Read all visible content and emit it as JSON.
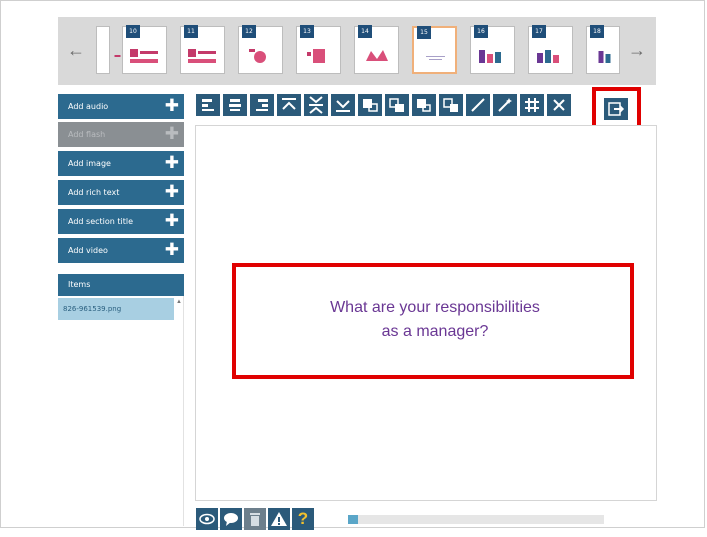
{
  "thumbnails": [
    {
      "num": "",
      "active": false
    },
    {
      "num": "10",
      "active": false
    },
    {
      "num": "11",
      "active": false
    },
    {
      "num": "12",
      "active": false
    },
    {
      "num": "13",
      "active": false
    },
    {
      "num": "14",
      "active": false
    },
    {
      "num": "15",
      "active": true
    },
    {
      "num": "16",
      "active": false
    },
    {
      "num": "17",
      "active": false
    },
    {
      "num": "18",
      "active": false
    }
  ],
  "nav": {
    "prev_icon": "arrow-left-icon",
    "next_icon": "arrow-right-icon"
  },
  "left_panel": {
    "buttons": [
      {
        "label": "Add audio",
        "enabled": true
      },
      {
        "label": "Add flash",
        "enabled": false
      },
      {
        "label": "Add image",
        "enabled": true
      },
      {
        "label": "Add rich text",
        "enabled": true
      },
      {
        "label": "Add section title",
        "enabled": true
      },
      {
        "label": "Add video",
        "enabled": true
      }
    ],
    "plus_glyph": "✚",
    "items_heading": "Items",
    "items": [
      "826-961539.png"
    ]
  },
  "toolbar": {
    "icons": [
      "align-left-icon",
      "align-center-icon",
      "align-right-icon",
      "align-top-icon",
      "align-middle-icon",
      "align-bottom-icon",
      "bring-front-icon",
      "bring-forward-icon",
      "send-backward-icon",
      "send-back-icon",
      "draw-line-icon",
      "magic-wand-icon",
      "grid-icon",
      "close-icon",
      "export-icon"
    ]
  },
  "slide": {
    "text_line1": "What are your responsibilities",
    "text_line2": "as a manager?"
  },
  "bottom_bar": {
    "icons": [
      "preview-eye-icon",
      "comment-icon",
      "trash-icon",
      "warning-icon",
      "help-icon"
    ],
    "help_glyph": "?",
    "progress": 0.04
  },
  "colors": {
    "accent": "#2c6a8f",
    "highlight": "#e00000",
    "slide_text": "#6a3794"
  }
}
